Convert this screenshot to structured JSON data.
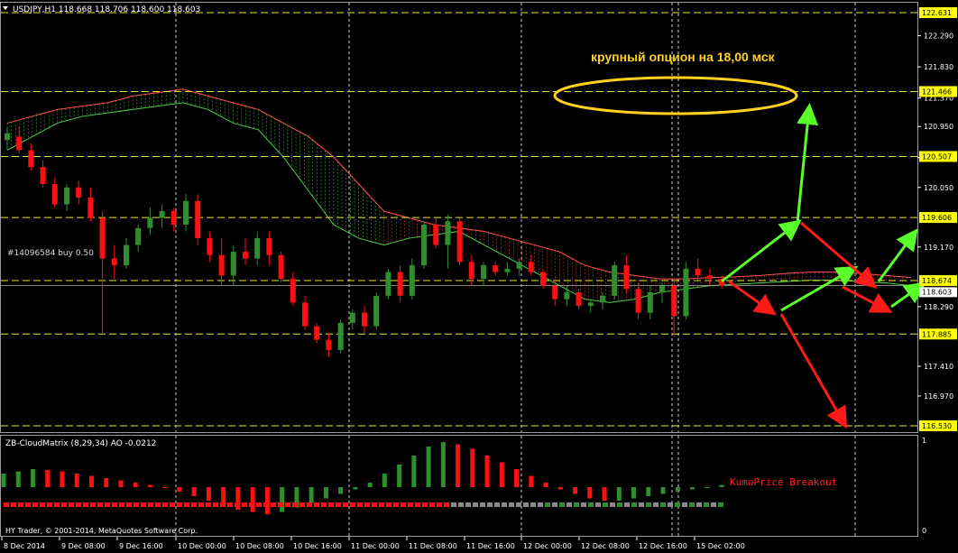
{
  "colors": {
    "background": "#000000",
    "grid": "#ffffff",
    "bull": "#2f8f2f",
    "bear": "#ff1010",
    "cloud_green_line": "#4bcf4b",
    "cloud_red_line": "#ff5050",
    "level_line": "#e8e830",
    "label_bg": "#ffff00",
    "ellipse": "#ffd21e",
    "arrow_green": "#5aff2a",
    "arrow_red": "#ff1a1a",
    "annotation_text": "#ffd21e",
    "breakout_text": "#ff2020",
    "osc_neutral": "#8a8a8a"
  },
  "header": {
    "symbol_line": "USDJPY,H1  118.668 118.706 118.600 118.603"
  },
  "annotations": {
    "option_note": "крупный опцион на 18,00 мск",
    "order_label": "#14096584 buy 0.50",
    "breakout_label": "KumoPrice Breakout"
  },
  "indicator": {
    "title": "ZB-CloudMatrix (8,29,34)  AO -0.0212",
    "scale_top": "1",
    "scale_bottom": "0"
  },
  "footer": {
    "copyright": "HY Trader, © 2001-2014, MetaQuotes Software Corp."
  },
  "price_axis": {
    "ticks": [
      "122.290",
      "121.830",
      "121.370",
      "120.950",
      "120.490",
      "120.050",
      "119.170",
      "118.290",
      "117.410",
      "116.970"
    ],
    "tick_values": [
      122.29,
      121.83,
      121.37,
      120.95,
      120.49,
      120.05,
      119.17,
      118.29,
      117.41,
      116.97
    ],
    "level_labels": [
      "122.631",
      "121.466",
      "120.507",
      "119.606",
      "118.674",
      "117.885",
      "116.530"
    ],
    "level_values": [
      122.631,
      121.466,
      120.507,
      119.606,
      118.674,
      117.885,
      116.53
    ],
    "current_price": "118.603",
    "current_value": 118.603
  },
  "time_axis": {
    "labels": [
      "8 Dec 2014",
      "9 Dec 08:00",
      "9 Dec 16:00",
      "10 Dec 00:00",
      "10 Dec 08:00",
      "10 Dec 16:00",
      "11 Dec 00:00",
      "11 Dec 08:00",
      "11 Dec 16:00",
      "12 Dec 00:00",
      "12 Dec 08:00",
      "12 Dec 16:00",
      "15 Dec 02:00"
    ]
  },
  "chart_data": {
    "type": "candlestick",
    "symbol": "USDJPY",
    "timeframe": "H1",
    "ylim": [
      116.53,
      122.631
    ],
    "price_levels": [
      122.631,
      121.466,
      120.507,
      119.606,
      118.674,
      117.885,
      116.53
    ],
    "cloud_upper": [
      121.0,
      121.1,
      121.2,
      121.25,
      121.3,
      121.4,
      121.45,
      121.5,
      121.4,
      121.3,
      121.2,
      121.0,
      120.8,
      120.5,
      120.1,
      119.7,
      119.6,
      119.5,
      119.45,
      119.4,
      119.3,
      119.2,
      119.1,
      118.9,
      118.8,
      118.75,
      118.7,
      118.7,
      118.72,
      118.73,
      118.75,
      118.78,
      118.8,
      118.8,
      118.78,
      118.75,
      118.72
    ],
    "cloud_lower": [
      120.6,
      120.8,
      121.0,
      121.1,
      121.15,
      121.2,
      121.25,
      121.3,
      121.2,
      121.0,
      120.9,
      120.5,
      120.0,
      119.5,
      119.3,
      119.2,
      119.3,
      119.35,
      119.4,
      119.2,
      119.0,
      118.8,
      118.6,
      118.4,
      118.35,
      118.4,
      118.5,
      118.55,
      118.6,
      118.62,
      118.64,
      118.66,
      118.68,
      118.68,
      118.66,
      118.64,
      118.6
    ],
    "candles": [
      {
        "o": 120.75,
        "h": 120.95,
        "l": 120.6,
        "c": 120.85
      },
      {
        "o": 120.8,
        "h": 120.95,
        "l": 120.55,
        "c": 120.6
      },
      {
        "o": 120.6,
        "h": 120.7,
        "l": 120.3,
        "c": 120.35
      },
      {
        "o": 120.35,
        "h": 120.45,
        "l": 120.05,
        "c": 120.1
      },
      {
        "o": 120.1,
        "h": 120.2,
        "l": 119.75,
        "c": 119.8
      },
      {
        "o": 119.8,
        "h": 120.1,
        "l": 119.7,
        "c": 120.05
      },
      {
        "o": 120.05,
        "h": 120.15,
        "l": 119.8,
        "c": 119.9
      },
      {
        "o": 119.9,
        "h": 120.05,
        "l": 119.55,
        "c": 119.6
      },
      {
        "o": 119.6,
        "h": 119.7,
        "l": 117.9,
        "c": 119.0
      },
      {
        "o": 119.0,
        "h": 119.2,
        "l": 118.7,
        "c": 118.9
      },
      {
        "o": 118.9,
        "h": 119.3,
        "l": 118.85,
        "c": 119.2
      },
      {
        "o": 119.2,
        "h": 119.5,
        "l": 119.1,
        "c": 119.45
      },
      {
        "o": 119.45,
        "h": 119.75,
        "l": 119.35,
        "c": 119.6
      },
      {
        "o": 119.6,
        "h": 119.8,
        "l": 119.45,
        "c": 119.7
      },
      {
        "o": 119.7,
        "h": 119.75,
        "l": 119.4,
        "c": 119.5
      },
      {
        "o": 119.5,
        "h": 119.95,
        "l": 119.4,
        "c": 119.85
      },
      {
        "o": 119.85,
        "h": 119.95,
        "l": 119.2,
        "c": 119.3
      },
      {
        "o": 119.3,
        "h": 119.4,
        "l": 118.95,
        "c": 119.05
      },
      {
        "o": 119.05,
        "h": 119.3,
        "l": 118.6,
        "c": 118.75
      },
      {
        "o": 118.75,
        "h": 119.2,
        "l": 118.6,
        "c": 119.1
      },
      {
        "o": 119.1,
        "h": 119.3,
        "l": 118.9,
        "c": 119.0
      },
      {
        "o": 119.0,
        "h": 119.4,
        "l": 118.9,
        "c": 119.3
      },
      {
        "o": 119.3,
        "h": 119.4,
        "l": 118.9,
        "c": 119.05
      },
      {
        "o": 119.05,
        "h": 119.1,
        "l": 118.65,
        "c": 118.7
      },
      {
        "o": 118.7,
        "h": 118.8,
        "l": 118.3,
        "c": 118.35
      },
      {
        "o": 118.35,
        "h": 118.45,
        "l": 117.95,
        "c": 118.0
      },
      {
        "o": 118.0,
        "h": 118.05,
        "l": 117.75,
        "c": 117.8
      },
      {
        "o": 117.8,
        "h": 117.9,
        "l": 117.55,
        "c": 117.65
      },
      {
        "o": 117.65,
        "h": 118.1,
        "l": 117.6,
        "c": 118.05
      },
      {
        "o": 118.05,
        "h": 118.25,
        "l": 117.95,
        "c": 118.2
      },
      {
        "o": 118.2,
        "h": 118.3,
        "l": 117.9,
        "c": 118.0
      },
      {
        "o": 118.0,
        "h": 118.5,
        "l": 117.95,
        "c": 118.45
      },
      {
        "o": 118.45,
        "h": 118.85,
        "l": 118.4,
        "c": 118.8
      },
      {
        "o": 118.8,
        "h": 118.9,
        "l": 118.35,
        "c": 118.45
      },
      {
        "o": 118.45,
        "h": 119.0,
        "l": 118.4,
        "c": 118.9
      },
      {
        "o": 118.9,
        "h": 119.55,
        "l": 118.85,
        "c": 119.5
      },
      {
        "o": 119.5,
        "h": 119.6,
        "l": 119.15,
        "c": 119.2
      },
      {
        "o": 119.2,
        "h": 119.65,
        "l": 118.85,
        "c": 119.55
      },
      {
        "o": 119.55,
        "h": 119.6,
        "l": 118.9,
        "c": 118.95
      },
      {
        "o": 118.95,
        "h": 119.05,
        "l": 118.6,
        "c": 118.7
      },
      {
        "o": 118.7,
        "h": 118.95,
        "l": 118.6,
        "c": 118.9
      },
      {
        "o": 118.9,
        "h": 118.95,
        "l": 118.75,
        "c": 118.8
      },
      {
        "o": 118.8,
        "h": 118.95,
        "l": 118.75,
        "c": 118.85
      },
      {
        "o": 118.85,
        "h": 119.0,
        "l": 118.75,
        "c": 118.95
      },
      {
        "o": 118.95,
        "h": 119.05,
        "l": 118.75,
        "c": 118.8
      },
      {
        "o": 118.8,
        "h": 118.85,
        "l": 118.55,
        "c": 118.6
      },
      {
        "o": 118.6,
        "h": 118.7,
        "l": 118.3,
        "c": 118.4
      },
      {
        "o": 118.4,
        "h": 118.6,
        "l": 118.3,
        "c": 118.5
      },
      {
        "o": 118.5,
        "h": 118.55,
        "l": 118.25,
        "c": 118.3
      },
      {
        "o": 118.3,
        "h": 118.4,
        "l": 118.2,
        "c": 118.35
      },
      {
        "o": 118.35,
        "h": 118.5,
        "l": 118.25,
        "c": 118.45
      },
      {
        "o": 118.45,
        "h": 118.95,
        "l": 118.4,
        "c": 118.9
      },
      {
        "o": 118.9,
        "h": 119.05,
        "l": 118.5,
        "c": 118.55
      },
      {
        "o": 118.55,
        "h": 118.65,
        "l": 118.1,
        "c": 118.2
      },
      {
        "o": 118.2,
        "h": 118.6,
        "l": 118.1,
        "c": 118.5
      },
      {
        "o": 118.5,
        "h": 118.65,
        "l": 118.35,
        "c": 118.6
      },
      {
        "o": 118.6,
        "h": 118.7,
        "l": 117.85,
        "c": 118.15
      },
      {
        "o": 118.15,
        "h": 118.95,
        "l": 118.1,
        "c": 118.85
      },
      {
        "o": 118.85,
        "h": 119.0,
        "l": 118.7,
        "c": 118.75
      },
      {
        "o": 118.75,
        "h": 118.85,
        "l": 118.6,
        "c": 118.7
      },
      {
        "o": 118.7,
        "h": 118.75,
        "l": 118.55,
        "c": 118.6
      }
    ],
    "oscillator": {
      "name": "AO",
      "value": -0.0212,
      "values": [
        0.3,
        0.35,
        0.4,
        0.38,
        0.35,
        0.3,
        0.25,
        0.2,
        0.15,
        0.1,
        0.05,
        0.0,
        -0.1,
        -0.2,
        -0.3,
        -0.4,
        -0.5,
        -0.55,
        -0.6,
        -0.55,
        -0.45,
        -0.35,
        -0.25,
        -0.15,
        -0.05,
        0.1,
        0.3,
        0.5,
        0.7,
        0.9,
        1.0,
        0.95,
        0.85,
        0.7,
        0.55,
        0.4,
        0.25,
        0.1,
        -0.05,
        -0.15,
        -0.25,
        -0.3,
        -0.3,
        -0.25,
        -0.2,
        -0.15,
        -0.1,
        -0.05,
        0.0,
        0.05
      ]
    }
  }
}
